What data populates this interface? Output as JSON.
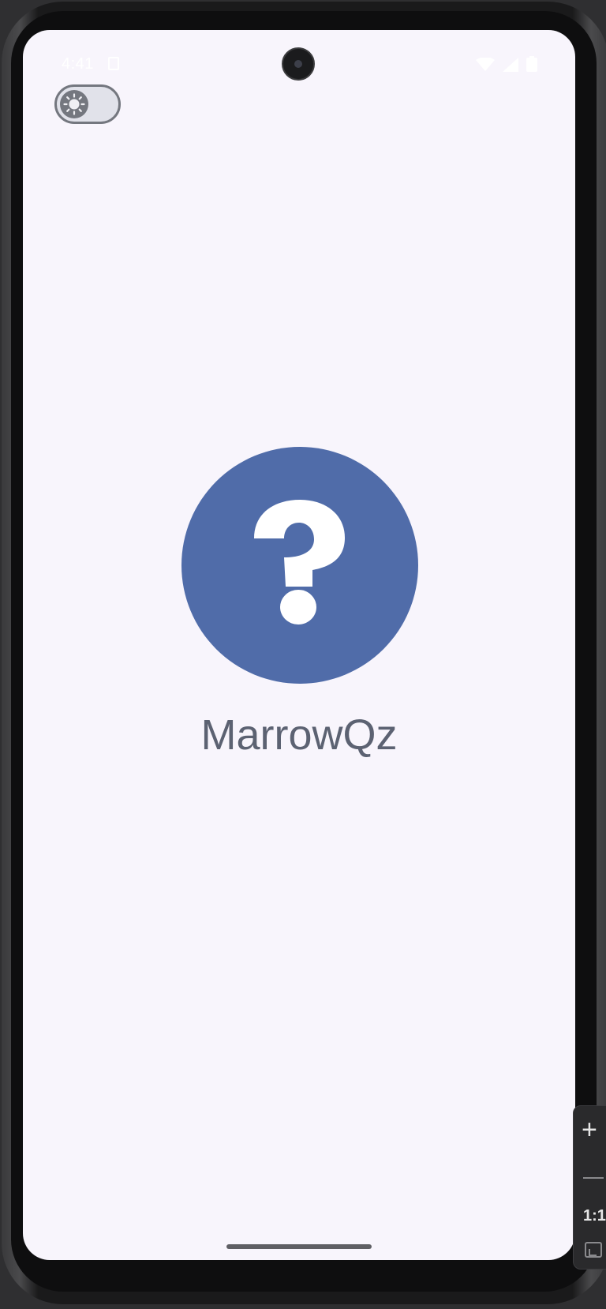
{
  "status_bar": {
    "time": "4:41",
    "icons": [
      "sim-card-icon",
      "wifi-icon",
      "cell-signal-icon",
      "battery-icon"
    ]
  },
  "theme_toggle": {
    "icon": "sun-icon",
    "state": "light"
  },
  "splash": {
    "logo_icon": "question-mark-icon",
    "logo_color": "#506ca9",
    "app_name": "MarrowQz",
    "text_color": "#5c6272",
    "background": "#f8f5fc"
  },
  "zoom_controls": {
    "zoom_in": "+",
    "ratio": "1:1",
    "icons": [
      "plus-icon",
      "minus-icon",
      "fit-screen-icon"
    ]
  }
}
